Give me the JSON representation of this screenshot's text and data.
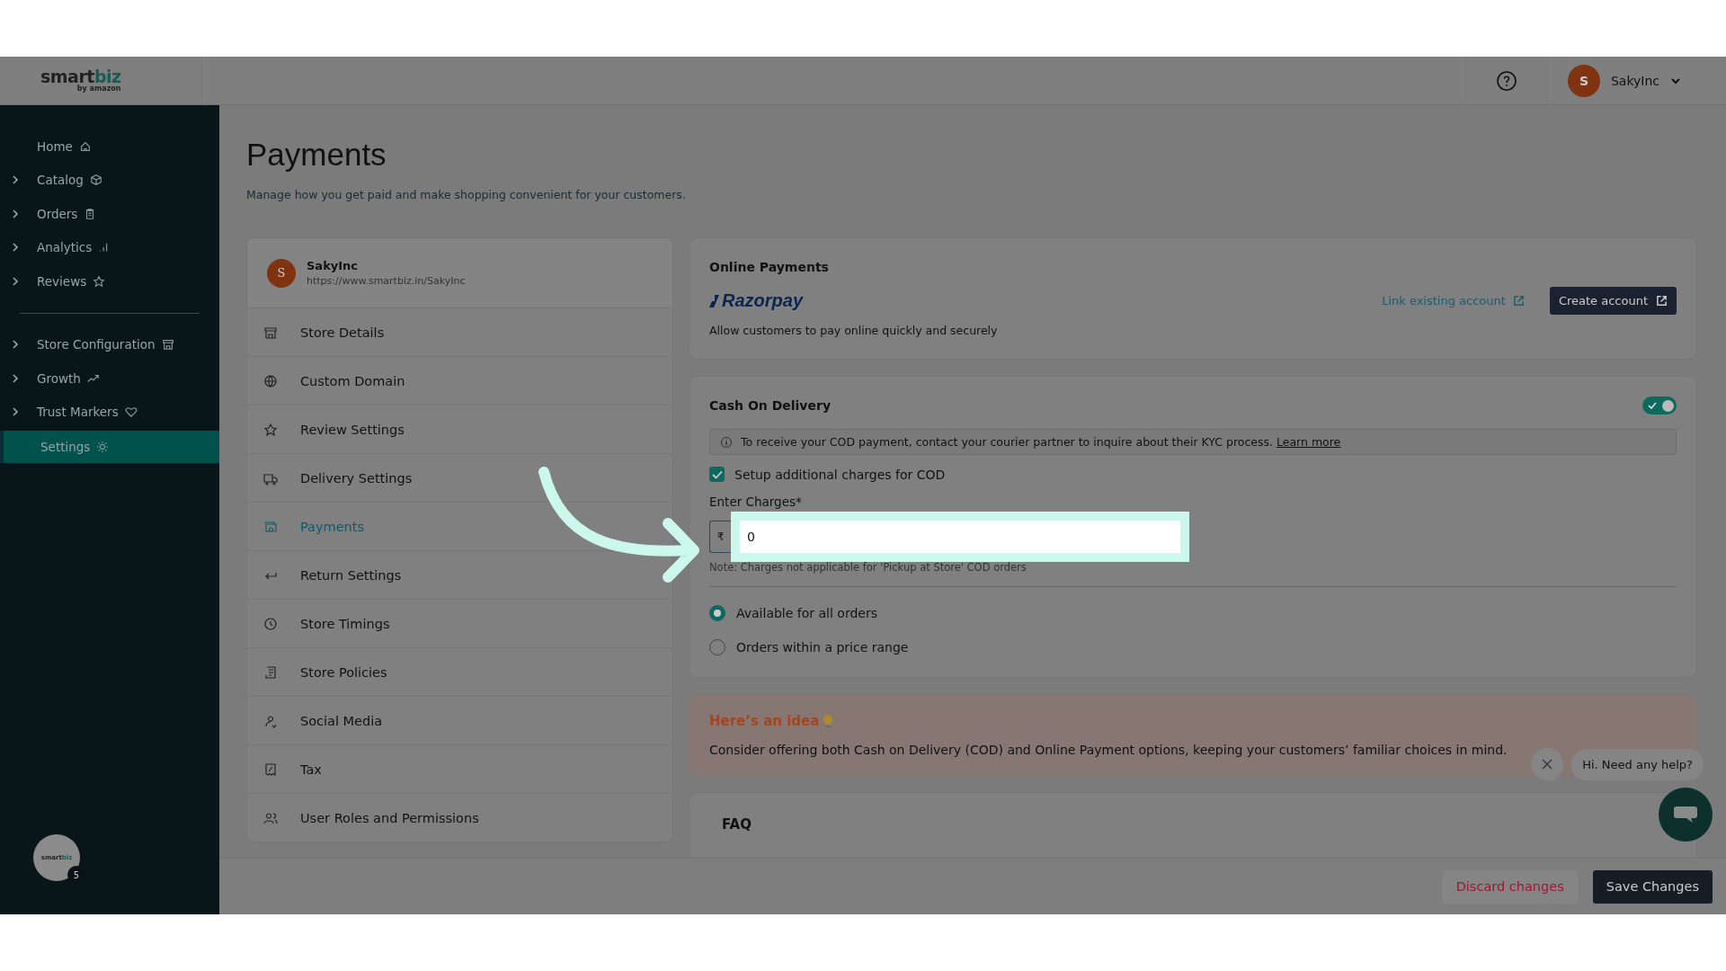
{
  "header": {
    "logo_part1": "smart",
    "logo_part2": "biz",
    "logo_sub": "by amazon",
    "user": {
      "initial": "S",
      "name": "SakyInc"
    }
  },
  "sidebar": {
    "sections": [
      {
        "items": [
          {
            "label": "Home",
            "expandable": false,
            "selected": false
          },
          {
            "label": "Catalog",
            "expandable": true,
            "selected": false
          },
          {
            "label": "Orders",
            "expandable": true,
            "selected": false
          },
          {
            "label": "Analytics",
            "expandable": true,
            "selected": false
          },
          {
            "label": "Reviews",
            "expandable": true,
            "selected": false
          }
        ]
      },
      {
        "items": [
          {
            "label": "Store Configuration",
            "expandable": true,
            "selected": false
          },
          {
            "label": "Growth",
            "expandable": true,
            "selected": false
          },
          {
            "label": "Trust Markers",
            "expandable": true,
            "selected": false
          },
          {
            "label": "Settings",
            "expandable": false,
            "selected": true
          }
        ]
      }
    ],
    "bot": {
      "logo_part1": "smart",
      "logo_part2": "biz",
      "badge": "5"
    }
  },
  "page": {
    "title": "Payments",
    "subtitle": "Manage how you get paid and make shopping convenient for your customers."
  },
  "store": {
    "initial": "S",
    "name": "SakyInc",
    "url": "https://www.smartbiz.in/SakyInc"
  },
  "settings_menu": [
    {
      "label": "Store Details",
      "selected": false
    },
    {
      "label": "Custom Domain",
      "selected": false
    },
    {
      "label": "Review Settings",
      "selected": false
    },
    {
      "label": "Delivery Settings",
      "selected": false
    },
    {
      "label": "Payments",
      "selected": true
    },
    {
      "label": "Return Settings",
      "selected": false
    },
    {
      "label": "Store Timings",
      "selected": false
    },
    {
      "label": "Store Policies",
      "selected": false
    },
    {
      "label": "Social Media",
      "selected": false
    },
    {
      "label": "Tax",
      "selected": false
    },
    {
      "label": "User Roles and Permissions",
      "selected": false
    }
  ],
  "online_payments": {
    "title": "Online Payments",
    "provider": "Razorpay",
    "description": "Allow customers to pay online quickly and securely",
    "link": "Link existing account",
    "button": "Create account"
  },
  "cod": {
    "title": "Cash On Delivery",
    "enabled": true,
    "notice": "To receive your COD payment, contact your courier partner to inquire about their KYC process.",
    "notice_link": "Learn more",
    "extra_charges": {
      "label": "Setup additional charges for COD",
      "checked": true
    },
    "charges": {
      "label": "Enter Charges*",
      "currency": "₹",
      "value": "0",
      "note": "Note: Charges not applicable for 'Pickup at Store' COD orders"
    },
    "availability": [
      {
        "label": "Available for all orders",
        "selected": true
      },
      {
        "label": "Orders within a price range",
        "selected": false
      }
    ]
  },
  "idea": {
    "title": "Here’s an idea",
    "text": "Consider offering both Cash on Delivery (COD) and Online Payment options, keeping your customers’ familiar choices in mind."
  },
  "faq": {
    "title": "FAQ"
  },
  "footer": {
    "buttons": [
      {
        "label": "Discard changes",
        "kind": "secondary"
      },
      {
        "label": "Save Changes",
        "kind": "primary"
      }
    ]
  },
  "chat": {
    "greeting": "Hi. Need any help?"
  }
}
